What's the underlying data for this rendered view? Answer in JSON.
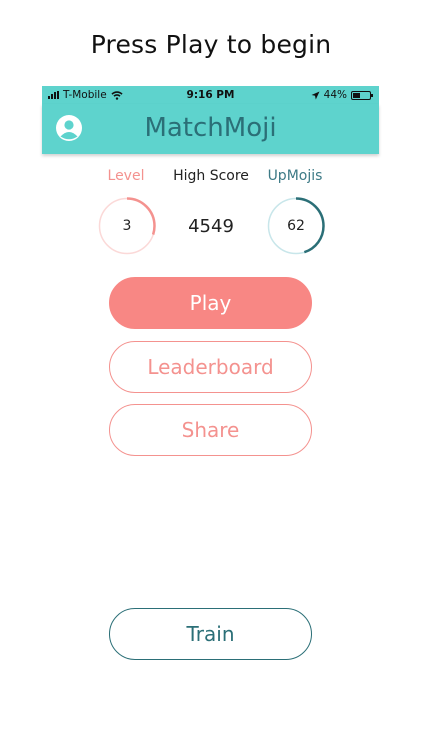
{
  "caption": "Press Play to begin",
  "status_bar": {
    "carrier": "T-Mobile",
    "time": "9:16 PM",
    "battery": "44%",
    "battery_level": 0.44
  },
  "navbar": {
    "title": "MatchMoji",
    "profile_icon": "user-circle-icon",
    "background_color": "#5ed3cd",
    "title_color": "#2b6f77"
  },
  "stats": {
    "level": {
      "label": "Level",
      "value": "3",
      "progress": 0.3,
      "color": "#f4928f"
    },
    "high_score": {
      "label": "High Score",
      "value": "4549"
    },
    "upmojis": {
      "label": "UpMojis",
      "value": "62",
      "progress": 0.45,
      "color": "#2b6f77"
    }
  },
  "buttons": {
    "play": "Play",
    "leaderboard": "Leaderboard",
    "share": "Share",
    "train": "Train"
  },
  "colors": {
    "accent_pink": "#f88784",
    "accent_teal": "#2b6f77"
  }
}
